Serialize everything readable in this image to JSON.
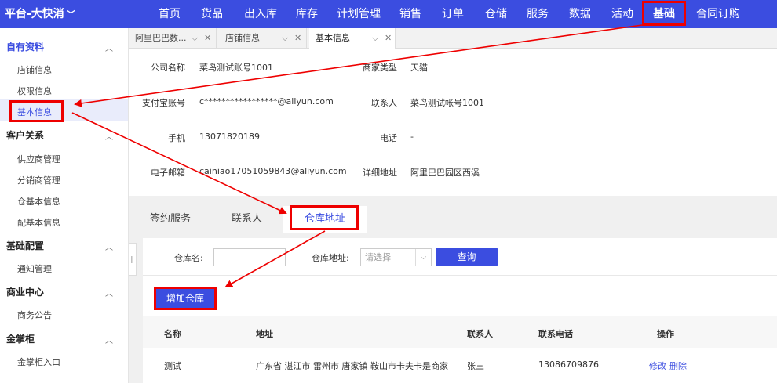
{
  "topbar": {
    "brand": "平台-大快消",
    "nav": [
      "首页",
      "货品",
      "出入库",
      "库存",
      "计划管理",
      "销售",
      "订单",
      "仓储",
      "服务",
      "数据",
      "活动",
      "基础",
      "合同订购"
    ]
  },
  "sidebar": {
    "sections": [
      {
        "label": "自有资料",
        "items": [
          "店铺信息",
          "权限信息",
          "基本信息"
        ]
      },
      {
        "label": "客户关系",
        "items": [
          "供应商管理",
          "分销商管理",
          "仓基本信息",
          "配基本信息"
        ]
      },
      {
        "label": "基础配置",
        "items": [
          "通知管理"
        ]
      },
      {
        "label": "商业中心",
        "items": [
          "商务公告"
        ]
      },
      {
        "label": "金掌柜",
        "items": [
          "金掌柜入口"
        ]
      }
    ]
  },
  "tabs": [
    "阿里巴巴数...",
    "店铺信息",
    "基本信息"
  ],
  "info": {
    "company_label": "公司名称",
    "company_value": "菜鸟测试账号1001",
    "merchant_type_label": "商家类型",
    "merchant_type_value": "天猫",
    "alipay_label": "支付宝账号",
    "alipay_value": "c*****************@aliyun.com",
    "contact_label": "联系人",
    "contact_value": "菜鸟测试帐号1001",
    "mobile_label": "手机",
    "mobile_value": "13071820189",
    "phone_label": "电话",
    "phone_value": "-",
    "email_label": "电子邮箱",
    "email_value": "cainiao17051059843@aliyun.com",
    "address_label": "详细地址",
    "address_value": "阿里巴巴园区西溪"
  },
  "subtabs": [
    "签约服务",
    "联系人",
    "仓库地址"
  ],
  "filter": {
    "name_label": "仓库名:",
    "address_label": "仓库地址:",
    "select_placeholder": "请选择",
    "query_button": "查询"
  },
  "add_button": "增加仓库",
  "table": {
    "headers": [
      "名称",
      "地址",
      "联系人",
      "联系电话",
      "操作"
    ],
    "rows": [
      {
        "name": "测试",
        "address": "广东省 湛江市 雷州市 唐家镇 鞍山市卡夫卡是商家",
        "contact": "张三",
        "phone": "13086709876",
        "edit": "修改",
        "delete": "删除"
      }
    ]
  },
  "colors": {
    "primary": "#3b4de0",
    "highlight": "#e00000"
  }
}
